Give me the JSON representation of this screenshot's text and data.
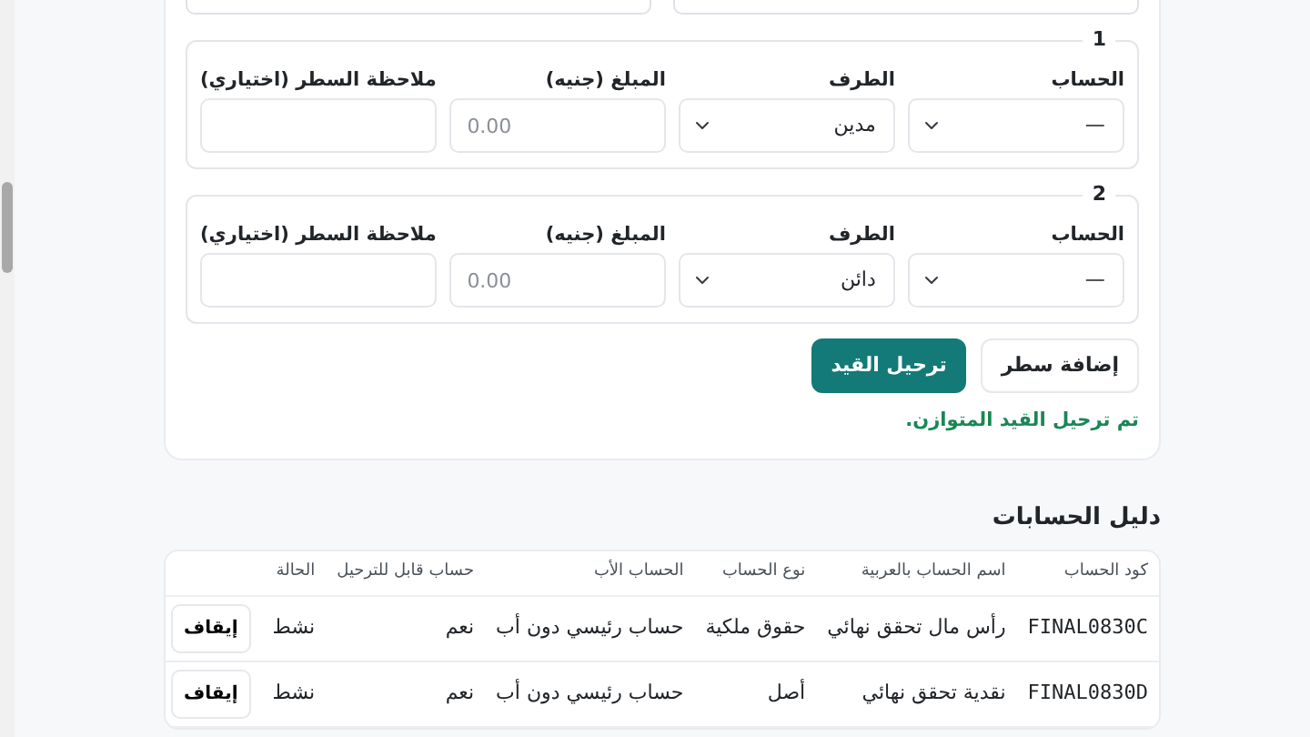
{
  "journal_lines": [
    {
      "number": "1",
      "account_label": "الحساب",
      "account_value": "—",
      "side_label": "الطرف",
      "side_value": "مدين",
      "amount_label": "المبلغ (جنيه)",
      "amount_placeholder": "0.00",
      "note_label": "ملاحظة السطر (اختياري)"
    },
    {
      "number": "2",
      "account_label": "الحساب",
      "account_value": "—",
      "side_label": "الطرف",
      "side_value": "دائن",
      "amount_label": "المبلغ (جنيه)",
      "amount_placeholder": "0.00",
      "note_label": "ملاحظة السطر (اختياري)"
    }
  ],
  "buttons": [
    {
      "label": "إضافة سطر",
      "kind": "secondary"
    },
    {
      "label": "ترحيل القيد",
      "kind": "primary"
    }
  ],
  "success_message": "تم ترحيل القيد المتوازن.",
  "chart_of_accounts": {
    "title": "دليل الحسابات",
    "columns": [
      "كود الحساب",
      "اسم الحساب بالعربية",
      "نوع الحساب",
      "الحساب الأب",
      "حساب قابل للترحيل",
      "الحالة"
    ],
    "rows": [
      {
        "code": "FINAL0830C",
        "name": "رأس مال تحقق نهائي",
        "type": "حقوق ملكية",
        "parent": "حساب رئيسي دون أب",
        "postable": "نعم",
        "status": "نشط",
        "action": "إيقاف"
      },
      {
        "code": "FINAL0830D",
        "name": "نقدية تحقق نهائي",
        "type": "أصل",
        "parent": "حساب رئيسي دون أب",
        "postable": "نعم",
        "status": "نشط",
        "action": "إيقاف"
      }
    ]
  }
}
